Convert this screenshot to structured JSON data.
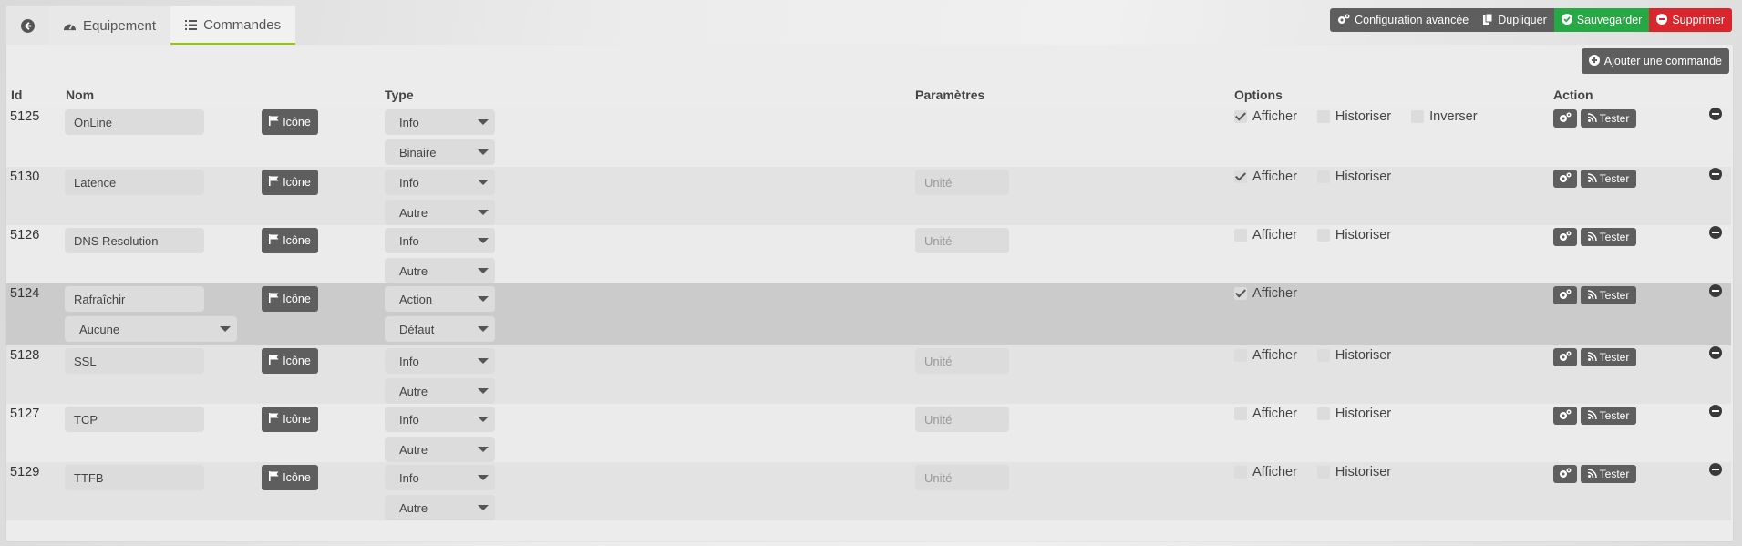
{
  "tabs": [
    {
      "label": ""
    },
    {
      "label": "Equipement"
    },
    {
      "label": "Commandes"
    }
  ],
  "toolbar": {
    "config_label": "Configuration avancée",
    "duplicate_label": "Dupliquer",
    "save_label": "Sauvegarder",
    "delete_label": "Supprimer"
  },
  "add_command_label": "Ajouter une commande",
  "table": {
    "headers": {
      "id": "Id",
      "nom": "Nom",
      "type": "Type",
      "parametres": "Paramètres",
      "options": "Options",
      "action": "Action"
    },
    "icon_button_label": "Icône",
    "test_button_label": "Tester",
    "option_labels": {
      "afficher": "Afficher",
      "historiser": "Historiser",
      "inverser": "Inverser"
    },
    "rows": [
      {
        "id": "5125",
        "name": "OnLine",
        "type": "Info",
        "subtype": "Binaire",
        "unit_placeholder": "",
        "afficher": true,
        "historiser": false,
        "inverser": false,
        "show_historiser": true,
        "show_inverser": true
      },
      {
        "id": "5130",
        "name": "Latence",
        "type": "Info",
        "subtype": "Autre",
        "unit_placeholder": "Unité",
        "afficher": true,
        "historiser": false,
        "show_historiser": true,
        "show_inverser": false
      },
      {
        "id": "5126",
        "name": "DNS Resolution",
        "type": "Info",
        "subtype": "Autre",
        "unit_placeholder": "Unité",
        "afficher": false,
        "historiser": false,
        "show_historiser": true,
        "show_inverser": false
      },
      {
        "id": "5124",
        "name": "Rafraîchir",
        "value_select": "Aucune",
        "type": "Action",
        "subtype": "Défaut",
        "unit_placeholder": "",
        "afficher": true,
        "show_historiser": false,
        "show_inverser": false
      },
      {
        "id": "5128",
        "name": "SSL",
        "type": "Info",
        "subtype": "Autre",
        "unit_placeholder": "Unité",
        "afficher": false,
        "historiser": false,
        "show_historiser": true,
        "show_inverser": false
      },
      {
        "id": "5127",
        "name": "TCP",
        "type": "Info",
        "subtype": "Autre",
        "unit_placeholder": "Unité",
        "afficher": false,
        "historiser": false,
        "show_historiser": true,
        "show_inverser": false
      },
      {
        "id": "5129",
        "name": "TTFB",
        "type": "Info",
        "subtype": "Autre",
        "unit_placeholder": "Unité",
        "afficher": false,
        "historiser": false,
        "show_historiser": true,
        "show_inverser": false
      }
    ]
  },
  "colors": {
    "accent": "#94ca02",
    "save": "#28a745",
    "delete": "#d9262c",
    "button": "#5e5e5e"
  },
  "icons": {
    "back": "arrow-left-circle-icon",
    "equipment": "tachometer-icon",
    "commands": "list-icon",
    "config": "cogs-icon",
    "duplicate": "copy-icon",
    "save": "check-circle-icon",
    "delete": "minus-circle-icon",
    "add": "plus-circle-icon",
    "icon_button": "flag-icon",
    "test": "rss-icon",
    "remove_row": "minus-circle-icon"
  }
}
